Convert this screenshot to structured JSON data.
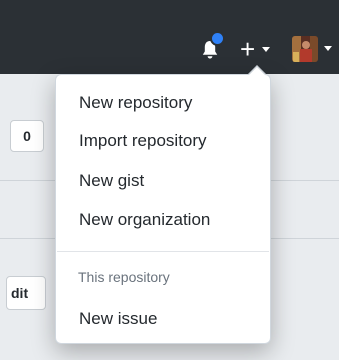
{
  "header": {
    "notification_icon": "bell-icon",
    "create_icon": "plus-icon",
    "create_glyph": "+",
    "avatar_icon": "user-avatar"
  },
  "page": {
    "count_value": "0",
    "edit_button_label": "dit"
  },
  "dropdown": {
    "items": [
      {
        "label": "New repository"
      },
      {
        "label": "Import repository"
      },
      {
        "label": "New gist"
      },
      {
        "label": "New organization"
      }
    ],
    "section_header": "This repository",
    "section_items": [
      {
        "label": "New issue"
      }
    ]
  },
  "colors": {
    "topbar": "#2b3035",
    "notification_dot": "#2f81f7",
    "menu_text": "#24292e",
    "section_text": "#6a737d"
  }
}
